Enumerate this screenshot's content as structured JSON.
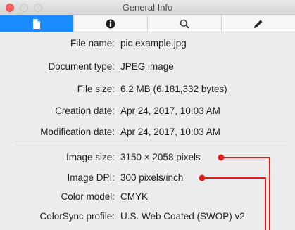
{
  "window": {
    "title": "General Info"
  },
  "tabs": [
    {
      "icon": "document-icon",
      "active": true
    },
    {
      "icon": "info-icon",
      "active": false
    },
    {
      "icon": "search-icon",
      "active": false
    },
    {
      "icon": "pencil-icon",
      "active": false
    }
  ],
  "general": [
    {
      "label": "File name:",
      "value": "pic example.jpg"
    },
    {
      "label": "Document type:",
      "value": "JPEG image"
    },
    {
      "label": "File size:",
      "value": "6.2 MB (6,181,332 bytes)"
    },
    {
      "label": "Creation date:",
      "value": "Apr 24, 2017, 10:03 AM"
    },
    {
      "label": "Modification date:",
      "value": "Apr 24, 2017, 10:03 AM"
    }
  ],
  "image_info": [
    {
      "label": "Image size:",
      "value": "3150 × 2058 pixels"
    },
    {
      "label": "Image DPI:",
      "value": "300 pixels/inch"
    },
    {
      "label": "Color model:",
      "value": "CMYK"
    },
    {
      "label": "ColorSync profile:",
      "value": "U.S. Web Coated (SWOP) v2"
    }
  ],
  "colors": {
    "accent": "#1a8cff",
    "annotation": "#e0201f",
    "close": "#fc605c"
  }
}
